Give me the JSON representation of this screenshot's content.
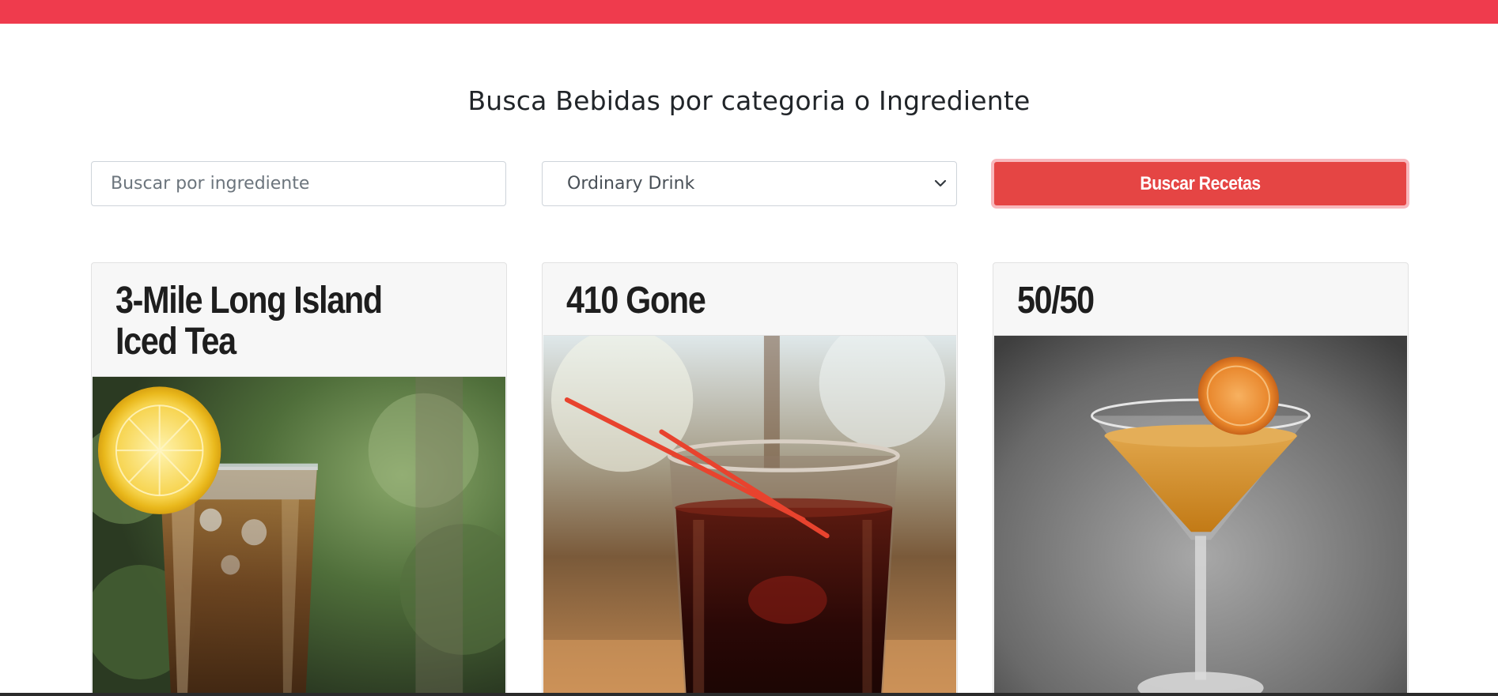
{
  "header": {
    "bar_color": "#ef3b4d"
  },
  "page": {
    "title": "Busca Bebidas por categoria o Ingrediente"
  },
  "search": {
    "ingredient_placeholder": "Buscar por ingrediente",
    "ingredient_value": "",
    "category_selected": "Ordinary Drink",
    "button_label": "Buscar Recetas",
    "button_color": "#e54544"
  },
  "drinks": [
    {
      "name": "3-Mile Long Island Iced Tea",
      "image": "iced-tea-with-lemon"
    },
    {
      "name": "410 Gone",
      "image": "dark-drink-with-straws"
    },
    {
      "name": "50/50",
      "image": "martini-with-orange"
    }
  ],
  "icons": {
    "select": "chevron-down-icon"
  }
}
